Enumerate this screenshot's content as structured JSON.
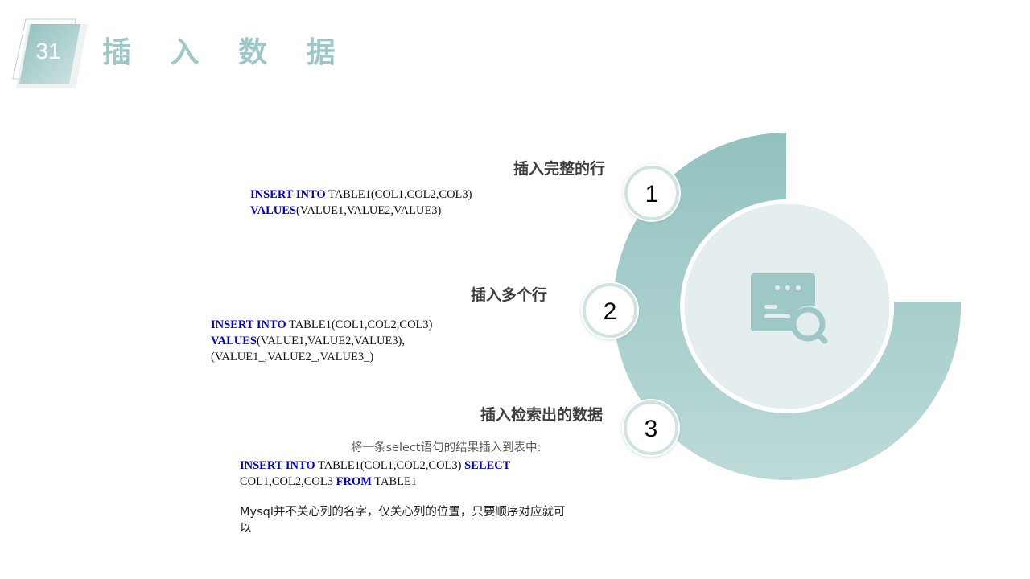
{
  "header": {
    "slide_number": "31",
    "title": "插 入 数 据"
  },
  "colors": {
    "accent": "#9dc8c6",
    "accent_light": "#e4eeee",
    "keyword": "#0000cc"
  },
  "diagram": {
    "center_icon": "document-search-icon",
    "steps": [
      {
        "number": "1"
      },
      {
        "number": "2"
      },
      {
        "number": "3"
      }
    ]
  },
  "sections": [
    {
      "heading": "插入完整的行",
      "code": [
        [
          {
            "kw": "INSERT INTO"
          },
          {
            "t": " TABLE1(COL1,COL2,COL3)"
          }
        ],
        [
          {
            "kw": "VALUES"
          },
          {
            "t": "(VALUE1,VALUE2,VALUE3)"
          }
        ]
      ]
    },
    {
      "heading": "插入多个行",
      "code": [
        [
          {
            "kw": "INSERT INTO"
          },
          {
            "t": " TABLE1(COL1,COL2,COL3)"
          }
        ],
        [
          {
            "kw": "VALUES"
          },
          {
            "t": "(VALUE1,VALUE2,VALUE3),"
          }
        ],
        [
          {
            "t": "(VALUE1_,VALUE2_,VALUE3_)"
          }
        ]
      ]
    },
    {
      "heading": "插入检索出的数据",
      "note": "将一条select语句的结果插入到表中:",
      "code": [
        [
          {
            "kw": "INSERT INTO"
          },
          {
            "t": " TABLE1(COL1,COL2,COL3) "
          },
          {
            "kw": "SELECT"
          }
        ],
        [
          {
            "t": "COL1,COL2,COL3 "
          },
          {
            "kw": "FROM"
          },
          {
            "t": " TABLE1"
          }
        ]
      ],
      "remark": "Mysql并不关心列的名字，仅关心列的位置，只要顺序对应就可以"
    }
  ]
}
